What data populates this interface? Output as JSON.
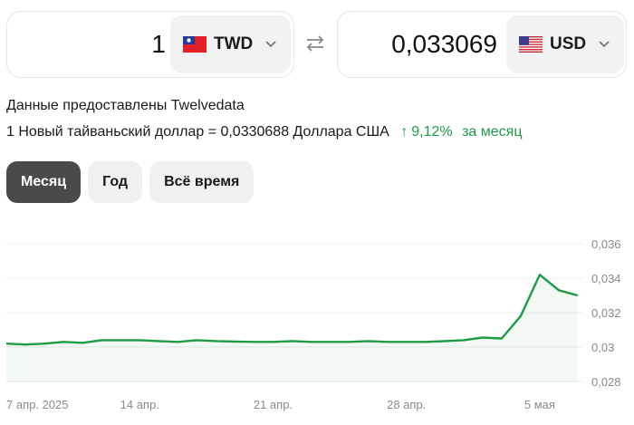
{
  "converter": {
    "from": {
      "amount": "1",
      "currency": "TWD",
      "flag_icon": "taiwan-flag-icon"
    },
    "to": {
      "amount": "0,033069",
      "currency": "USD",
      "flag_icon": "us-flag-icon"
    },
    "swap_icon": "swap-arrows-icon"
  },
  "info": {
    "source": "Данные предоставлены Twelvedata",
    "rate": "1 Новый тайваньский доллар = 0,0330688 Доллара США",
    "change_value": "9,12%",
    "change_period": "за месяц",
    "change_color": "#1e9b45"
  },
  "periods": [
    {
      "label": "Месяц",
      "active": true
    },
    {
      "label": "Год",
      "active": false
    },
    {
      "label": "Всё время",
      "active": false
    }
  ],
  "chart_data": {
    "type": "area",
    "line_color": "#1e9b45",
    "x_labels": [
      "7 апр. 2025",
      "14 апр.",
      "21 апр.",
      "28 апр.",
      "5 мая"
    ],
    "y_ticks": [
      "0,036",
      "0,034",
      "0,032",
      "0,03",
      "0,028"
    ],
    "ylim": [
      0.028,
      0.036
    ],
    "grid": true,
    "x": [
      "2025-04-07",
      "2025-04-08",
      "2025-04-09",
      "2025-04-10",
      "2025-04-11",
      "2025-04-12",
      "2025-04-13",
      "2025-04-14",
      "2025-04-15",
      "2025-04-16",
      "2025-04-17",
      "2025-04-18",
      "2025-04-19",
      "2025-04-20",
      "2025-04-21",
      "2025-04-22",
      "2025-04-23",
      "2025-04-24",
      "2025-04-25",
      "2025-04-26",
      "2025-04-27",
      "2025-04-28",
      "2025-04-29",
      "2025-04-30",
      "2025-05-01",
      "2025-05-02",
      "2025-05-03",
      "2025-05-04",
      "2025-05-05",
      "2025-05-06",
      "2025-05-07"
    ],
    "values": [
      0.0302,
      0.03015,
      0.0302,
      0.0303,
      0.03025,
      0.0304,
      0.0304,
      0.0304,
      0.03035,
      0.0303,
      0.0304,
      0.03035,
      0.03032,
      0.0303,
      0.0303,
      0.03035,
      0.0303,
      0.0303,
      0.0303,
      0.03035,
      0.0303,
      0.0303,
      0.0303,
      0.03035,
      0.0304,
      0.03055,
      0.0305,
      0.0318,
      0.0342,
      0.0333,
      0.033
    ]
  }
}
